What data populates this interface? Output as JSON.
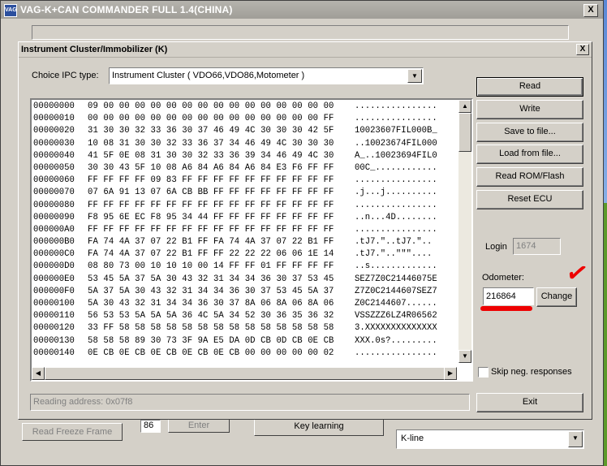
{
  "app": {
    "icon_text": "VAG",
    "title": "VAG-K+CAN COMMANDER FULL 1.4(CHINA)",
    "close_label": "X"
  },
  "lower": {
    "freeze_frame_label": "Read Freeze Frame",
    "small_value": "86",
    "enter_label": "Enter",
    "key_learning_label": "Key learning",
    "protocol_value": "K-line"
  },
  "dialog": {
    "title": "Instrument Cluster/Immobilizer (K)",
    "close_label": "X",
    "ipc_label": "Choice IPC type:",
    "ipc_value": "Instrument Cluster ( VDO66,VDO86,Motometer )",
    "buttons": {
      "read": "Read",
      "write": "Write",
      "save": "Save to file...",
      "load": "Load from file...",
      "read_rom": "Read ROM/Flash",
      "reset_ecu": "Reset ECU",
      "change": "Change",
      "exit": "Exit"
    },
    "login_label": "Login",
    "login_value": "1674",
    "odometer_label": "Odometer:",
    "odometer_value": "216864",
    "skip_label": "Skip neg. responses",
    "status_text": "Reading address: 0x07f8"
  },
  "hex": [
    {
      "addr": "00000000",
      "bytes": "09 00 00 00 00 00 00 00 00 00 00 00 00 00 00 00",
      "ascii": "................"
    },
    {
      "addr": "00000010",
      "bytes": "00 00 00 00 00 00 00 00 00 00 00 00 00 00 00 FF",
      "ascii": "................"
    },
    {
      "addr": "00000020",
      "bytes": "31 30 30 32 33 36 30 37 46 49 4C 30 30 30 42 5F",
      "ascii": "10023607FIL000B_"
    },
    {
      "addr": "00000030",
      "bytes": "10 08 31 30 30 32 33 36 37 34 46 49 4C 30 30 30",
      "ascii": "..10023674FIL000"
    },
    {
      "addr": "00000040",
      "bytes": "41 5F 0E 08 31 30 30 32 33 36 39 34 46 49 4C 30",
      "ascii": "A_..10023694FIL0"
    },
    {
      "addr": "00000050",
      "bytes": "30 30 43 5F 10 08 A6 84 A6 84 A6 84 E3 F6 FF FF",
      "ascii": "00C_............"
    },
    {
      "addr": "00000060",
      "bytes": "FF FF FF FF 09 83 FF FF FF FF FF FF FF FF FF FF",
      "ascii": "................"
    },
    {
      "addr": "00000070",
      "bytes": "07 6A 91 13 07 6A CB BB FF FF FF FF FF FF FF FF",
      "ascii": ".j...j.........."
    },
    {
      "addr": "00000080",
      "bytes": "FF FF FF FF FF FF FF FF FF FF FF FF FF FF FF FF",
      "ascii": "................"
    },
    {
      "addr": "00000090",
      "bytes": "F8 95 6E EC F8 95 34 44 FF FF FF FF FF FF FF FF",
      "ascii": "..n...4D........"
    },
    {
      "addr": "000000A0",
      "bytes": "FF FF FF FF FF FF FF FF FF FF FF FF FF FF FF FF",
      "ascii": "................"
    },
    {
      "addr": "000000B0",
      "bytes": "FA 74 4A 37 07 22 B1 FF FA 74 4A 37 07 22 B1 FF",
      "ascii": ".tJ7.\"..tJ7.\".."
    },
    {
      "addr": "000000C0",
      "bytes": "FA 74 4A 37 07 22 B1 FF FF 22 22 22 06 06 1E 14",
      "ascii": ".tJ7.\"..\"\"\"...."
    },
    {
      "addr": "000000D0",
      "bytes": "08 80 73 00 10 10 10 00 14 FF FF 01 FF FF FF FF",
      "ascii": "..s............."
    },
    {
      "addr": "000000E0",
      "bytes": "53 45 5A 37 5A 30 43 32 31 34 34 36 30 37 53 45",
      "ascii": "SEZ7Z0C21446075E"
    },
    {
      "addr": "000000F0",
      "bytes": "5A 37 5A 30 43 32 31 34 34 36 30 37 53 45 5A 37",
      "ascii": "Z7Z0C2144607SEZ7"
    },
    {
      "addr": "00000100",
      "bytes": "5A 30 43 32 31 34 34 36 30 37 8A 06 8A 06 8A 06",
      "ascii": "Z0C2144607......"
    },
    {
      "addr": "00000110",
      "bytes": "56 53 53 5A 5A 5A 36 4C 5A 34 52 30 36 35 36 32",
      "ascii": "VSSZZZ6LZ4R06562"
    },
    {
      "addr": "00000120",
      "bytes": "33 FF 58 58 58 58 58 58 58 58 58 58 58 58 58 58",
      "ascii": "3.XXXXXXXXXXXXXX"
    },
    {
      "addr": "00000130",
      "bytes": "58 58 58 89 30 73 3F 9A E5 DA 0D CB 0D CB 0E CB",
      "ascii": "XXX.0s?........."
    },
    {
      "addr": "00000140",
      "bytes": "0E CB 0E CB 0E CB 0E CB 0E CB 00 00 00 00 00 02",
      "ascii": "................"
    }
  ],
  "colors": {
    "annotation": "#e00000",
    "window_face": "#d4d0c8"
  }
}
